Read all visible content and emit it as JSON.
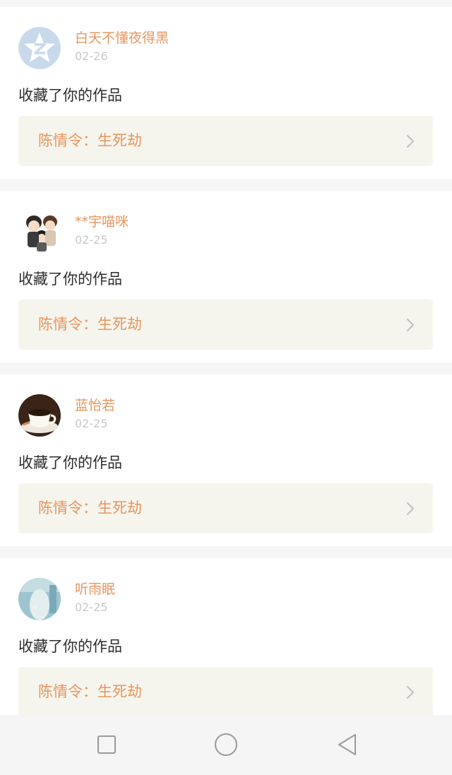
{
  "notifications": [
    {
      "username": "白天不懂夜得黑",
      "date": "02-26",
      "action": "收藏了你的作品",
      "work_title": "陈情令：生死劫",
      "avatar": "qq-star-avatar"
    },
    {
      "username": "**宇喵咪",
      "date": "02-25",
      "action": "收藏了你的作品",
      "work_title": "陈情令：生死劫",
      "avatar": "cartoon-couple-avatar"
    },
    {
      "username": "蓝怡若",
      "date": "02-25",
      "action": "收藏了你的作品",
      "work_title": "陈情令：生死劫",
      "avatar": "coffee-cup-avatar"
    },
    {
      "username": "听雨眠",
      "date": "02-25",
      "action": "收藏了你的作品",
      "work_title": "陈情令：生死劫",
      "avatar": "blue-figure-avatar"
    }
  ],
  "nav_bar": {
    "buttons": [
      "recent-apps-icon",
      "home-icon",
      "back-icon"
    ]
  },
  "colors": {
    "username": "#e8955e",
    "work_title": "#e8955e",
    "date": "#c9c9c9",
    "card_bg": "#ffffff",
    "work_link_bg": "#f5f5ee",
    "divider_bg": "#f7f6f6"
  }
}
